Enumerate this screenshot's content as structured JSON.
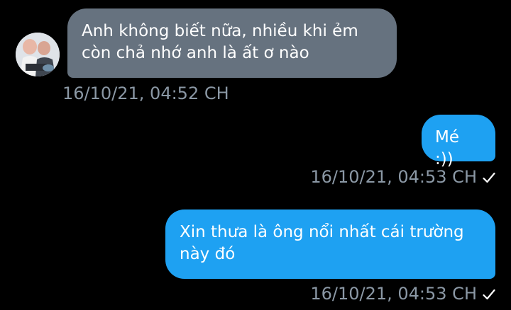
{
  "conversation": {
    "messages": [
      {
        "direction": "incoming",
        "text": "Anh không biết nữa, nhiều khi ẻm\ncòn chả nhớ anh là ất ơ nào",
        "timestamp": "16/10/21, 04:52 CH",
        "avatar_icon": "contact-avatar"
      },
      {
        "direction": "outgoing",
        "text": "Mé :))",
        "timestamp": "16/10/21, 04:53 CH",
        "status_icon": "checkmark-icon"
      },
      {
        "direction": "outgoing",
        "text": "Xin thưa là ông nổi nhất cái trường\nnày đó",
        "timestamp": "16/10/21, 04:53 CH",
        "status_icon": "checkmark-icon"
      }
    ]
  },
  "colors": {
    "background": "#000000",
    "incoming_bubble": "#66727f",
    "outgoing_bubble": "#1ea1f2",
    "timestamp": "#8b98a5",
    "text": "#ffffff"
  }
}
